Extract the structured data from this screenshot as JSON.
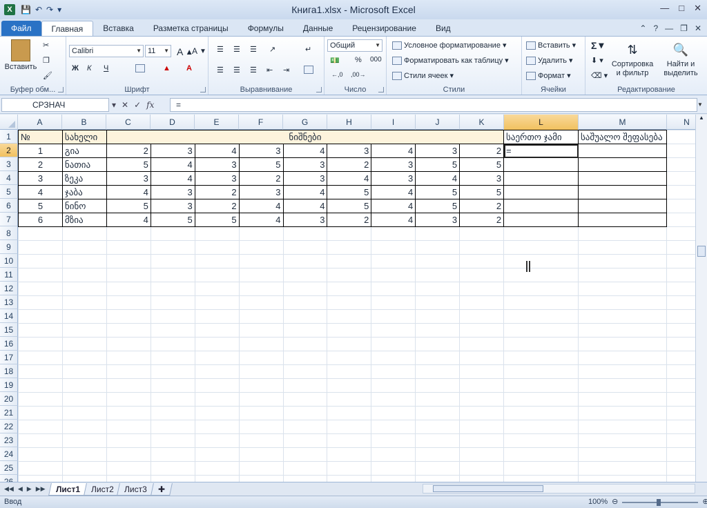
{
  "window": {
    "title": "Книга1.xlsx - Microsoft Excel",
    "app_icon": "X"
  },
  "qat": {
    "items": [
      "save-icon",
      "undo-icon",
      "redo-icon",
      "customize-icon"
    ]
  },
  "tabs": [
    "Файл",
    "Главная",
    "Вставка",
    "Разметка страницы",
    "Формулы",
    "Данные",
    "Рецензирование",
    "Вид"
  ],
  "active_tab": "Главная",
  "ribbon": {
    "clipboard": {
      "label": "Буфер обм...",
      "paste": "Вставить"
    },
    "font": {
      "label": "Шрифт",
      "name": "Calibri",
      "size": "11",
      "bold": "Ж",
      "italic": "К",
      "underline": "Ч"
    },
    "alignment": {
      "label": "Выравнивание"
    },
    "number": {
      "label": "Число",
      "format": "Общий",
      "percent": "%",
      "thousands": "000"
    },
    "styles": {
      "label": "Стили",
      "cond": "Условное форматирование",
      "table": "Форматировать как таблицу",
      "cell": "Стили ячеек"
    },
    "cells": {
      "label": "Ячейки",
      "insert": "Вставить",
      "delete": "Удалить",
      "format": "Формат"
    },
    "editing": {
      "label": "Редактирование",
      "sort": "Сортировка и фильтр",
      "find": "Найти и выделить",
      "sigma": "Σ"
    }
  },
  "formula_bar": {
    "name_box": "СРЗНАЧ",
    "fx": "fx",
    "content": "="
  },
  "columns": [
    "A",
    "B",
    "C",
    "D",
    "E",
    "F",
    "G",
    "H",
    "I",
    "J",
    "K",
    "L",
    "M",
    "N"
  ],
  "selected_column": "L",
  "rows": [
    "1",
    "2",
    "3",
    "4",
    "5",
    "6",
    "7",
    "8",
    "9",
    "10",
    "11",
    "12",
    "13",
    "14",
    "15",
    "16",
    "17",
    "18",
    "19",
    "20",
    "21",
    "22",
    "23",
    "24",
    "25",
    "26"
  ],
  "selected_row": "2",
  "sheet": {
    "header": {
      "a": "№",
      "b": "სახელი",
      "grades": "ნიშნები",
      "l": "საერთო ჯამი",
      "m": "საშუალო შეფასება"
    },
    "data": [
      {
        "n": "1",
        "name": "გია",
        "g": [
          "2",
          "3",
          "4",
          "3",
          "4",
          "3",
          "4",
          "3",
          "2"
        ]
      },
      {
        "n": "2",
        "name": "ნათია",
        "g": [
          "5",
          "4",
          "3",
          "5",
          "3",
          "2",
          "3",
          "5",
          "5"
        ]
      },
      {
        "n": "3",
        "name": "ზეკა",
        "g": [
          "3",
          "4",
          "3",
          "2",
          "3",
          "4",
          "3",
          "4",
          "3"
        ]
      },
      {
        "n": "4",
        "name": "ჯაბა",
        "g": [
          "4",
          "3",
          "2",
          "3",
          "4",
          "5",
          "4",
          "5",
          "5"
        ]
      },
      {
        "n": "5",
        "name": "ნინო",
        "g": [
          "5",
          "3",
          "2",
          "4",
          "4",
          "5",
          "4",
          "5",
          "2"
        ]
      },
      {
        "n": "6",
        "name": "მზია",
        "g": [
          "4",
          "5",
          "5",
          "4",
          "3",
          "2",
          "4",
          "3",
          "2"
        ]
      }
    ],
    "active_cell_value": "="
  },
  "sheet_tabs": [
    "Лист1",
    "Лист2",
    "Лист3"
  ],
  "active_sheet": "Лист1",
  "status": {
    "mode": "Ввод",
    "zoom": "100%"
  }
}
